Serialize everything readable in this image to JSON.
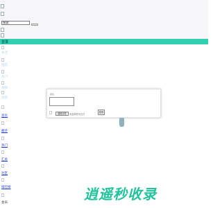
{
  "search": {
    "value": "搜索"
  },
  "greenbar": {
    "label": "登录"
  },
  "sidebar": {
    "faded_items": [
      "关注",
      "推荐",
      "热门",
      "视频",
      "消息"
    ],
    "link_items": [
      "首页",
      "圈子",
      "热门",
      "汇总",
      "社区",
      "排行榜"
    ],
    "footer": "会员"
  },
  "dialog": {
    "title": "评论",
    "file_button": "选择文件",
    "file_status": "未选择任何文件",
    "submit": "发布"
  },
  "logo": {
    "text": "逍遥秒收录"
  },
  "colors": {
    "accent": "#2fcfb0",
    "link": "#1c3bd4",
    "faded": "#b7d9e7",
    "logo": "#22c39c"
  }
}
